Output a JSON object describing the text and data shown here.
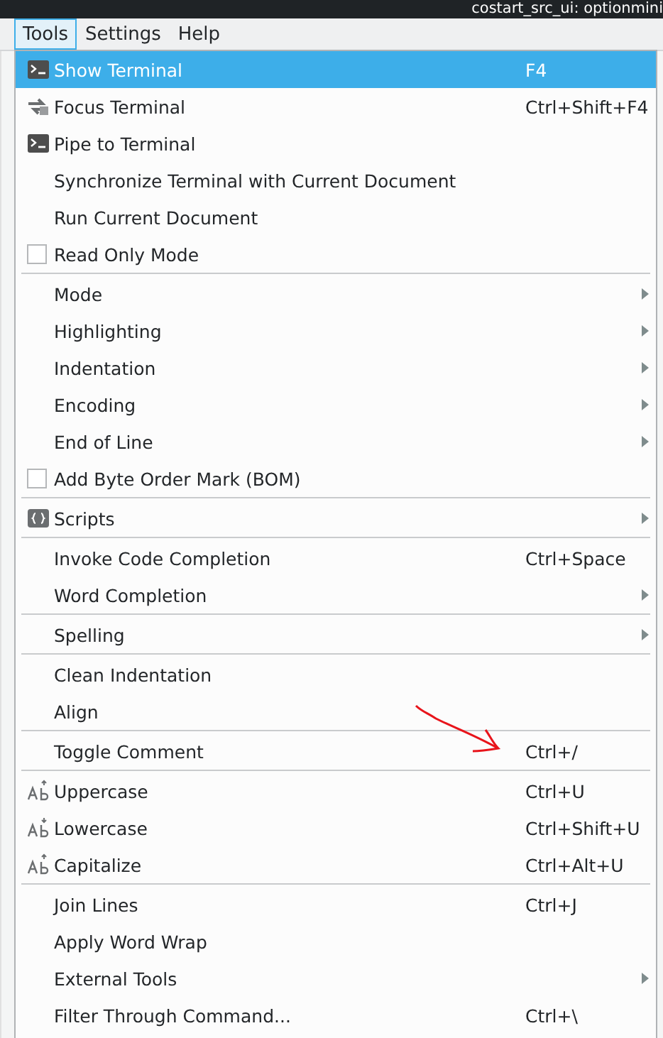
{
  "window": {
    "title": "costart_src_ui: optionmini"
  },
  "menubar": [
    {
      "label": "Tools",
      "selected": true
    },
    {
      "label": "Settings",
      "selected": false
    },
    {
      "label": "Help",
      "selected": false
    }
  ],
  "menu": {
    "groups": [
      [
        {
          "kind": "action",
          "label": "Show Terminal",
          "shortcut": "F4",
          "selected": true
        },
        {
          "kind": "action",
          "label": "Focus Terminal",
          "shortcut": "Ctrl+Shift+F4",
          "selected": false
        },
        {
          "kind": "action",
          "label": "Pipe to Terminal",
          "selected": false
        },
        {
          "kind": "action",
          "label": "Synchronize Terminal with Current Document",
          "selected": false
        },
        {
          "kind": "action",
          "label": "Run Current Document",
          "selected": false
        },
        {
          "kind": "checkbox",
          "label": "Read Only Mode",
          "checked": false,
          "selected": false
        }
      ],
      [
        {
          "kind": "submenu",
          "label": "Mode",
          "selected": false
        },
        {
          "kind": "submenu",
          "label": "Highlighting",
          "selected": false
        },
        {
          "kind": "submenu",
          "label": "Indentation",
          "selected": false
        },
        {
          "kind": "submenu",
          "label": "Encoding",
          "selected": false
        },
        {
          "kind": "submenu",
          "label": "End of Line",
          "selected": false
        },
        {
          "kind": "checkbox",
          "label": "Add Byte Order Mark (BOM)",
          "checked": false,
          "selected": false
        }
      ],
      [
        {
          "kind": "submenu",
          "label": "Scripts",
          "selected": false
        }
      ],
      [
        {
          "kind": "action",
          "label": "Invoke Code Completion",
          "shortcut": "Ctrl+Space",
          "selected": false
        },
        {
          "kind": "submenu",
          "label": "Word Completion",
          "selected": false
        }
      ],
      [
        {
          "kind": "submenu",
          "label": "Spelling",
          "selected": false
        }
      ],
      [
        {
          "kind": "action",
          "label": "Clean Indentation",
          "selected": false
        },
        {
          "kind": "action",
          "label": "Align",
          "selected": false
        }
      ],
      [
        {
          "kind": "action",
          "label": "Toggle Comment",
          "shortcut": "Ctrl+/",
          "selected": false
        }
      ],
      [
        {
          "kind": "action",
          "label": "Uppercase",
          "shortcut": "Ctrl+U",
          "selected": false
        },
        {
          "kind": "action",
          "label": "Lowercase",
          "shortcut": "Ctrl+Shift+U",
          "selected": false
        },
        {
          "kind": "action",
          "label": "Capitalize",
          "shortcut": "Ctrl+Alt+U",
          "selected": false
        }
      ],
      [
        {
          "kind": "action",
          "label": "Join Lines",
          "shortcut": "Ctrl+J",
          "selected": false
        },
        {
          "kind": "action",
          "label": "Apply Word Wrap",
          "selected": false
        },
        {
          "kind": "submenu",
          "label": "External Tools",
          "selected": false
        },
        {
          "kind": "action",
          "label": "Filter Through Command...",
          "shortcut": "Ctrl+\\",
          "selected": false
        }
      ]
    ]
  }
}
